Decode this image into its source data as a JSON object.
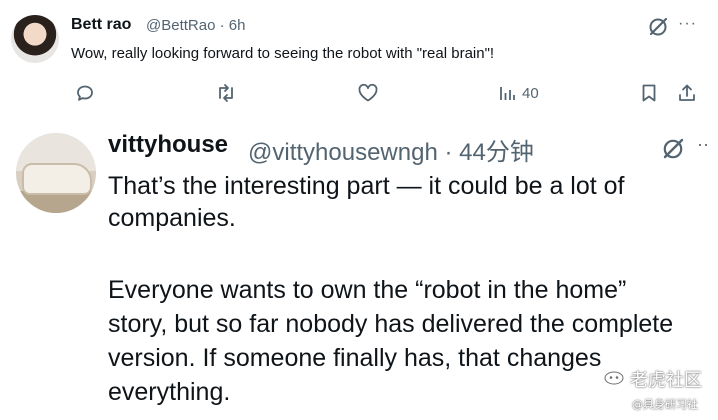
{
  "tweet1": {
    "display_name": "Bett rao",
    "meta": "@BettRao · 6h",
    "text": "Wow, really looking forward to seeing the robot with \"real brain\"!",
    "views": "40",
    "more": "···"
  },
  "tweet2": {
    "display_name": "vittyhouse",
    "meta": "@vittyhousewngh · 44分钟",
    "more": "··",
    "lines": [
      "That’s the interesting part — it could be a lot of",
      "companies.",
      "Everyone wants to own the “robot in the home”",
      "story, but so far nobody has delivered the complete",
      "version. If someone finally has, that changes",
      "everything."
    ]
  },
  "watermark": {
    "title": "老虎社区",
    "subtitle": "@具身研习社"
  }
}
